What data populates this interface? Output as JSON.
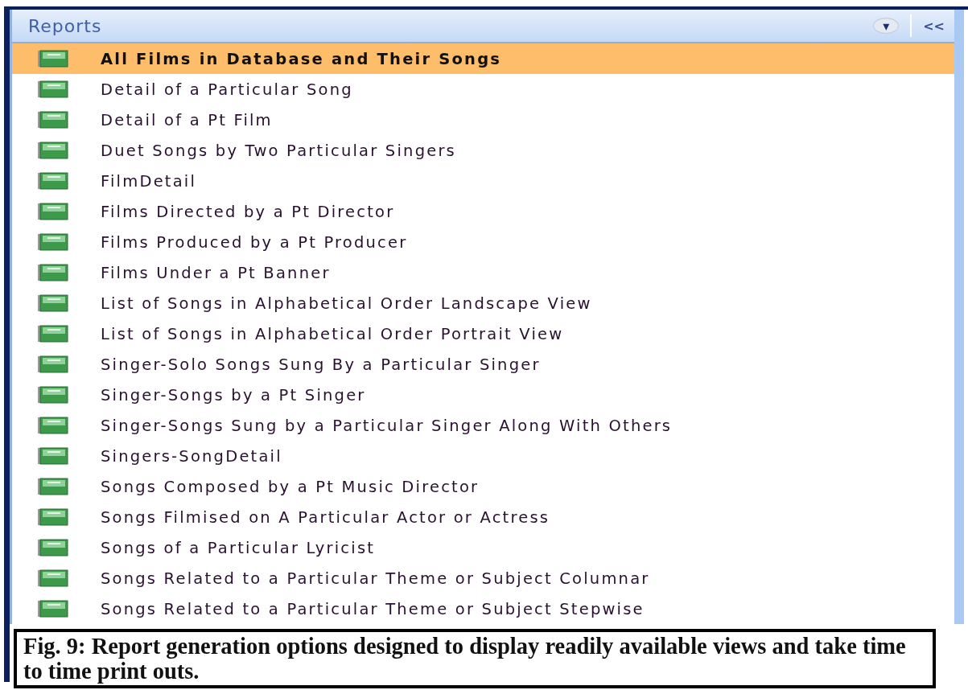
{
  "pane": {
    "title": "Reports",
    "menu_button": "▾",
    "collapse_button": "<<",
    "items": [
      {
        "label": "All Films in Database and Their Songs",
        "selected": true
      },
      {
        "label": "Detail of a Particular Song",
        "selected": false
      },
      {
        "label": "Detail of a Pt Film",
        "selected": false
      },
      {
        "label": "Duet Songs by Two Particular Singers",
        "selected": false
      },
      {
        "label": "FilmDetail",
        "selected": false
      },
      {
        "label": "Films Directed by a Pt Director",
        "selected": false
      },
      {
        "label": "Films Produced by a Pt Producer",
        "selected": false
      },
      {
        "label": "Films Under a Pt Banner",
        "selected": false
      },
      {
        "label": "List of Songs in Alphabetical Order Landscape View",
        "selected": false
      },
      {
        "label": "List of Songs in Alphabetical Order Portrait View",
        "selected": false
      },
      {
        "label": "Singer-Solo Songs Sung By a Particular Singer",
        "selected": false
      },
      {
        "label": "Singer-Songs by a Pt Singer",
        "selected": false
      },
      {
        "label": "Singer-Songs Sung by a Particular Singer Along With Others",
        "selected": false
      },
      {
        "label": "Singers-SongDetail",
        "selected": false
      },
      {
        "label": "Songs Composed by a Pt Music Director",
        "selected": false
      },
      {
        "label": "Songs Filmised on A Particular Actor or Actress",
        "selected": false
      },
      {
        "label": "Songs of a Particular Lyricist",
        "selected": false
      },
      {
        "label": "Songs Related to a Particular Theme or Subject Columnar",
        "selected": false
      },
      {
        "label": "Songs Related to a Particular Theme or Subject Stepwise",
        "selected": false
      }
    ]
  },
  "caption": "Fig. 9: Report generation options designed to display readily available views and take time to time print outs."
}
